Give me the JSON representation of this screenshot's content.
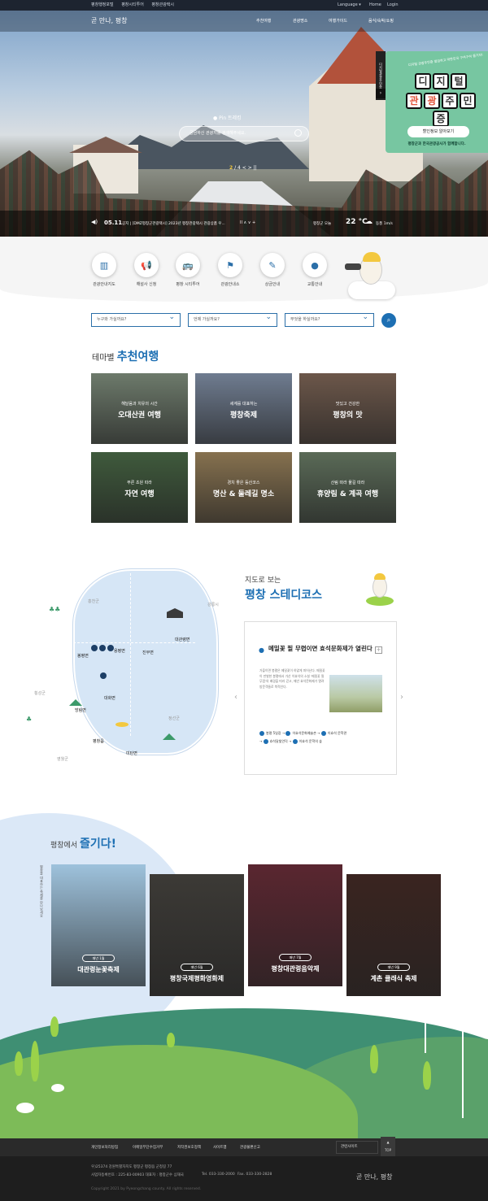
{
  "topbar": {
    "links": [
      "평창행정포털",
      "평창시티투어",
      "평창관광택시"
    ],
    "language": "Language",
    "home": "Home",
    "login": "Login"
  },
  "nav": {
    "logo": "곧 만나, 평창",
    "items": [
      "추천여행",
      "관광명소",
      "여행가이드",
      "음식/숙박/쇼핑"
    ]
  },
  "hero": {
    "location": "Pin 트레킹",
    "search_placeholder": "궁금하신 관광지를 검색해주세요.",
    "page_current": "2",
    "page_total": "/ 4",
    "controls": "< >  ||"
  },
  "banner": {
    "vtab": "디지털관광주민증",
    "subtitle": "디지털 관광주민증 발급하고 대한민국 구석구석 즐기자!",
    "chars1": [
      "디",
      "지",
      "털"
    ],
    "chars2": [
      "관",
      "광",
      "주",
      "민",
      "증"
    ],
    "button": "할인정보 알아보기",
    "footer": "평창군과 한국관광공사가 함께합니다."
  },
  "ticker": {
    "date": "05.11",
    "label": "공지",
    "text": "[DMZ평창군관광택시] 2023년 평창관광택시 관광상품 우...",
    "controls": "II ∧ ∨ +",
    "weather_loc": "평창군 오늘",
    "temp": "22 °C",
    "wind": "동풍 1m/s"
  },
  "quickmenu": [
    {
      "icon": "map-icon",
      "label": "관광안내지도"
    },
    {
      "icon": "megaphone-icon",
      "label": "해설사 신청"
    },
    {
      "icon": "bus-icon",
      "label": "평창 시티투어"
    },
    {
      "icon": "signpost-icon",
      "label": "관광안내소"
    },
    {
      "icon": "tag-icon",
      "label": "상금안내"
    },
    {
      "icon": "location-icon",
      "label": "교통안내"
    }
  ],
  "filters": [
    "누구와 가실까요?",
    "언제 가실까요?",
    "무엇을 하실까요?"
  ],
  "themes": {
    "label": "테마별",
    "title": "추천여행",
    "cards": [
      {
        "sub": "해달음과 치유의 시간",
        "title": "오대산권 여행",
        "bg": "#6d7a6b"
      },
      {
        "sub": "세계를 대표하는",
        "title": "평창축제",
        "bg": "#6f7c90"
      },
      {
        "sub": "맛있고 건강한",
        "title": "평창의 맛",
        "bg": "#6c574a"
      },
      {
        "sub": "푸른 초원 따라",
        "title": "자연 여행",
        "bg": "#3f5a3c"
      },
      {
        "sub": "경치 좋은 등산코스",
        "title": "명산 & 둘레길 명소",
        "bg": "#86714f"
      },
      {
        "sub": "산림 따라 물길 따라",
        "title": "휴양림 & 계곡 여행",
        "bg": "#5a6a57"
      }
    ]
  },
  "map": {
    "head": "지도로 보는",
    "title": "평창 스테디코스",
    "labels": [
      "봉평면",
      "용평면",
      "진부면",
      "대관령면",
      "대화면",
      "방림면",
      "평창읍",
      "미탄면"
    ],
    "outer": [
      "홍천군",
      "강릉시",
      "횡성군",
      "정선군",
      "영월군"
    ],
    "card_title": "메밀꽃 필 무렵이면 효석문화제가 열린다",
    "card_text": "가을이면 봉평은 메밀꽃이 하얗게 피어난다. 메밀꽃이 만발한 봉평에서 가산 이효석의 소설 '메밀꽃 필 무렵'의 배경을 따라 걷고, 매년 효석문화제가 열려 방문객들로 북적인다.",
    "route": [
      "봉평 5일장",
      "이효석문화예술촌",
      "이효석 문학관",
      "효석달빛언덕",
      "이효석 문학의 숲"
    ]
  },
  "festival": {
    "label": "평창에서",
    "title": "즐기다!",
    "side": "평창을 대표하는 축제를 만나보세요",
    "cards": [
      {
        "badge": "매년 1월",
        "title": "대관령눈꽃축제",
        "bg": "#9ec2dc"
      },
      {
        "badge": "매년 6월",
        "title": "평창국제평화영화제",
        "bg": "#3c3a36"
      },
      {
        "badge": "매년 7월",
        "title": "평창대관령음악제",
        "bg": "#5a2630"
      },
      {
        "badge": "매년 9월",
        "title": "계촌 클래식 축제",
        "bg": "#3a2420"
      }
    ]
  },
  "footer": {
    "links": [
      "개인정보처리방침",
      "이메일무단수집거부",
      "저작권보호정책",
      "사이트맵",
      "관광불편신고"
    ],
    "related": "관련사이트",
    "top": "TOP",
    "address": "우)25374 강원특별자치도 평창군 평창읍 군청길 77",
    "biz": "사업자등록번호 : 225-83-00903     대표자 : 평창군수 심재국",
    "tel": "Tel. 033-330-2000",
    "fax": "Fax. 033-330-2828",
    "copy": "Copyright 2021 by Pyeongchang county. All rights reserved.",
    "logo": "곧 만나, 평창"
  },
  "colors": {
    "primary": "#1d6fb3",
    "banner": "#77c6a1"
  }
}
